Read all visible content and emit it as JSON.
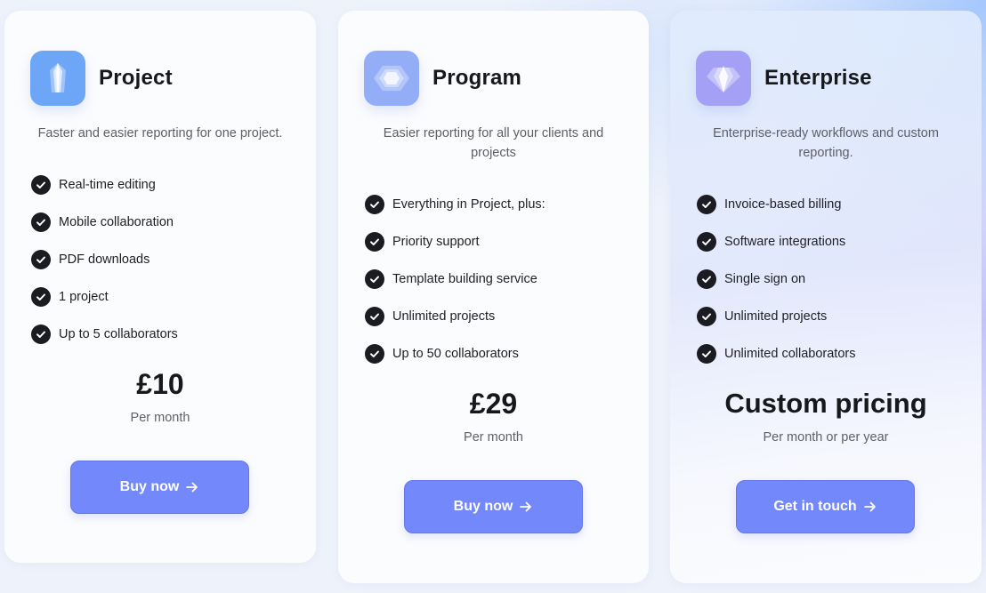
{
  "plans": [
    {
      "name": "Project",
      "icon": "crystal-icon",
      "icon_color": "#6ea6f7",
      "description": "Faster and easier reporting for one project.",
      "features": [
        "Real-time editing",
        "Mobile collaboration",
        "PDF downloads",
        "1 project",
        "Up to 5 collaborators"
      ],
      "price": "£10",
      "period": "Per month",
      "cta_label": "Buy now"
    },
    {
      "name": "Program",
      "icon": "hexagon-gem-icon",
      "icon_color": "#93aef7",
      "description": "Easier reporting for all your clients and projects",
      "features": [
        "Everything in Project, plus:",
        "Priority support",
        "Template building service",
        "Unlimited projects",
        "Up to 50 collaborators"
      ],
      "price": "£29",
      "period": "Per month",
      "cta_label": "Buy now"
    },
    {
      "name": "Enterprise",
      "icon": "diamond-icon",
      "icon_color": "#a3a0f6",
      "description": "Enterprise-ready workflows and custom reporting.",
      "features": [
        "Invoice-based billing",
        "Software integrations",
        "Single sign on",
        "Unlimited projects",
        "Unlimited collaborators"
      ],
      "price": "Custom pricing",
      "period": "Per month or per year",
      "cta_label": "Get in touch"
    }
  ],
  "colors": {
    "button": "#7388fb",
    "check": "#1b1c21",
    "heading": "#17181c"
  }
}
